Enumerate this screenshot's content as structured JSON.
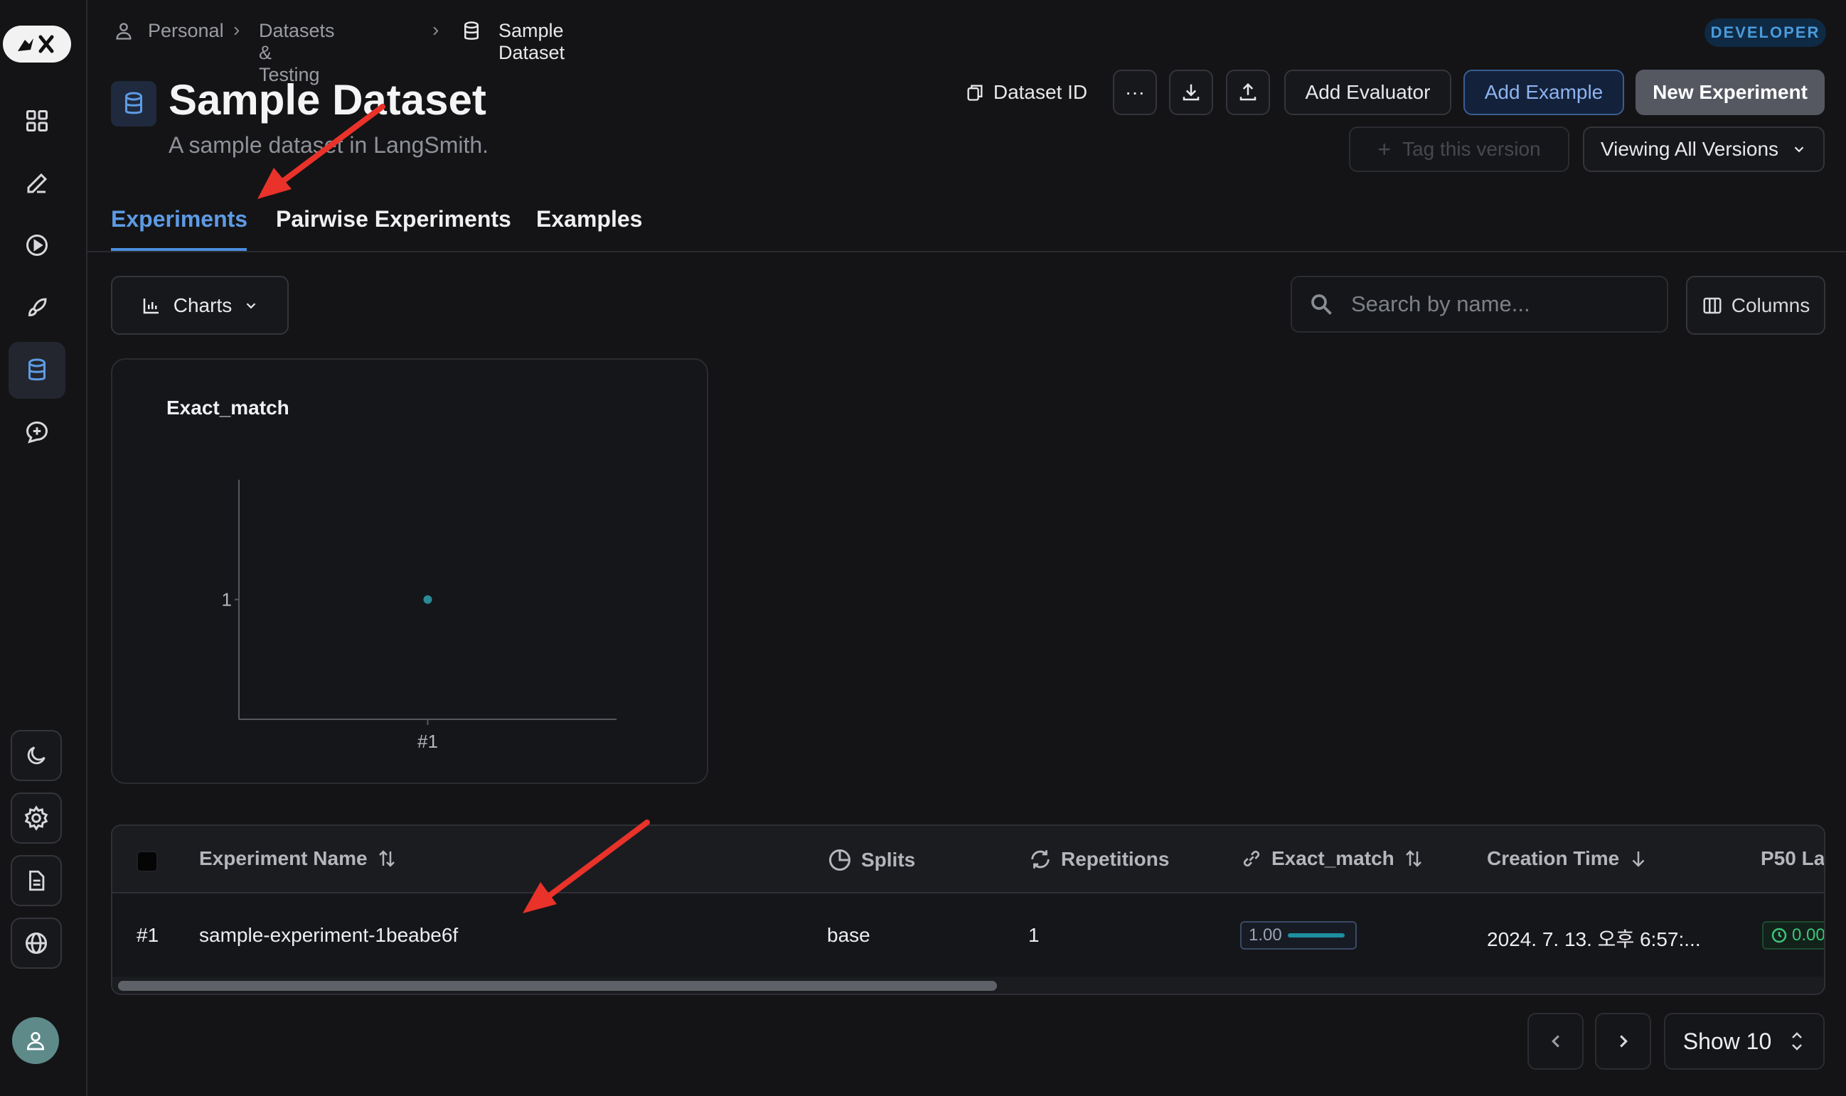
{
  "breadcrumb": {
    "items": [
      "Personal",
      "Datasets & Testing",
      "Sample Dataset"
    ]
  },
  "badge": "DEVELOPER",
  "dataset": {
    "title": "Sample Dataset",
    "subtitle": "A sample dataset in LangSmith."
  },
  "toolbar": {
    "dataset_id": "Dataset ID",
    "more": "···",
    "add_evaluator": "Add Evaluator",
    "add_example": "Add Example",
    "new_experiment": "New Experiment",
    "tag_version": "Tag this version",
    "versions": "Viewing All Versions"
  },
  "tabs": [
    "Experiments",
    "Pairwise Experiments",
    "Examples"
  ],
  "charts_button": "Charts",
  "search": {
    "placeholder": "Search by name..."
  },
  "columns_button": "Columns",
  "chart_data": {
    "type": "scatter",
    "title": "Exact_match",
    "x": [
      "#1"
    ],
    "y": [
      1
    ],
    "yticks": [
      "1"
    ],
    "color": "#2a8a96"
  },
  "table": {
    "headers": [
      "Experiment Name",
      "Splits",
      "Repetitions",
      "Exact_match",
      "Creation Time",
      "P50 La"
    ],
    "rows": [
      {
        "index": "#1",
        "name": "sample-experiment-1beabe6f",
        "splits": "base",
        "repetitions": "1",
        "exact_match": "1.00",
        "exact_match_fraction": 1.0,
        "creation_time": "2024. 7. 13. 오후 6:57:...",
        "p50_latency": "0.00"
      }
    ]
  },
  "pagination": {
    "show": "Show 10"
  },
  "colors": {
    "accent": "#4a8fe0",
    "annotation_arrow": "#e8322a",
    "score": "#1d8fa0",
    "latency": "#3fc37a"
  }
}
